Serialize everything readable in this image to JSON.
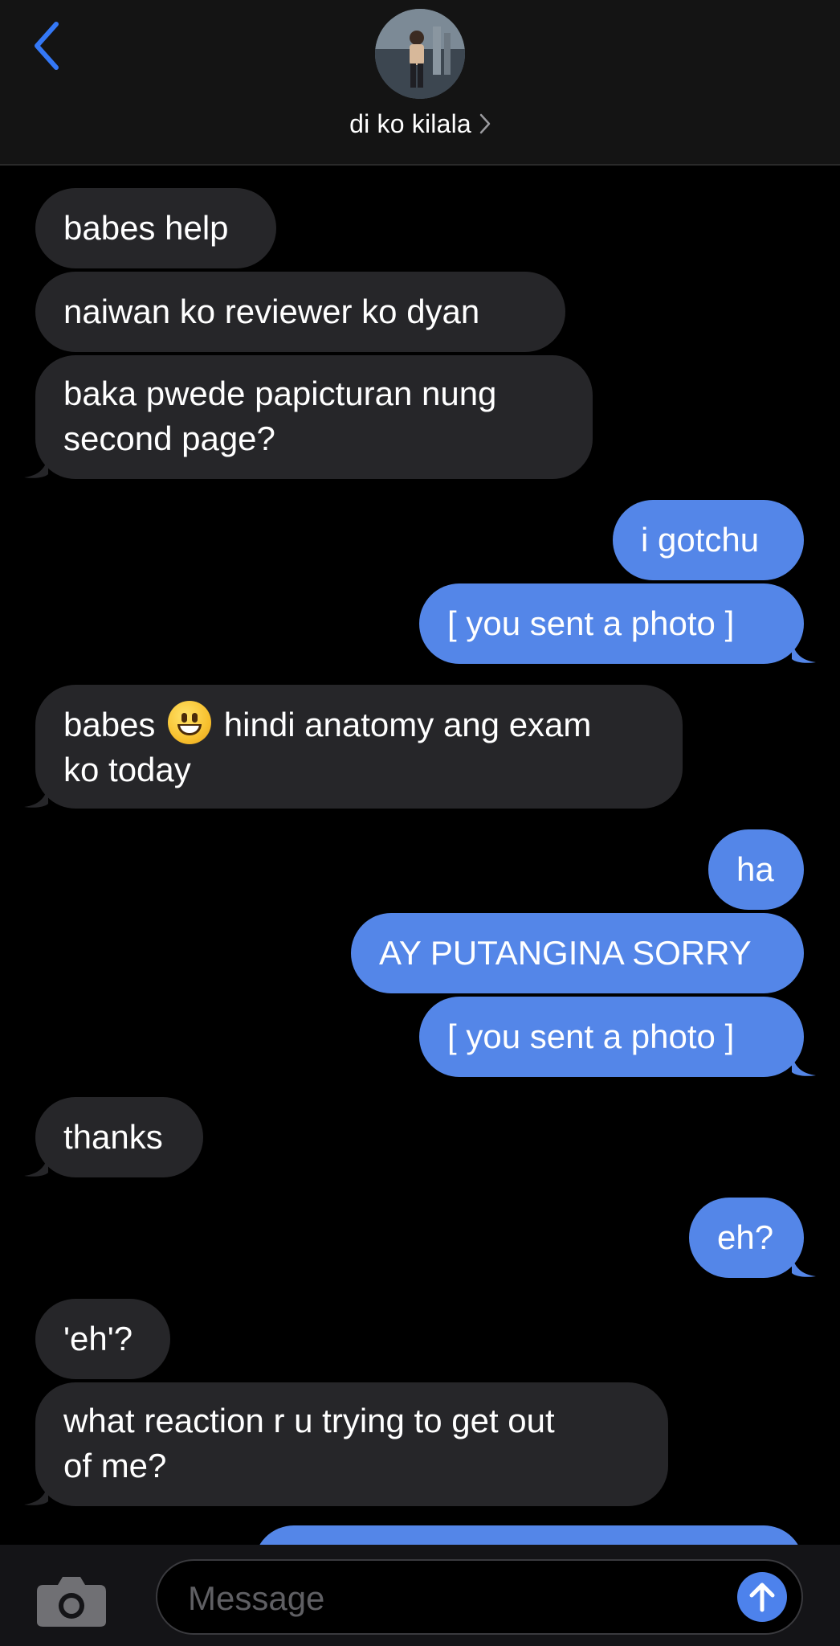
{
  "header": {
    "contact_name": "di ko kilala"
  },
  "messages": [
    {
      "direction": "incoming",
      "lines": [
        "babes help"
      ]
    },
    {
      "direction": "incoming",
      "lines": [
        "naiwan ko reviewer ko dyan"
      ]
    },
    {
      "direction": "incoming",
      "lines": [
        "baka pwede papicturan nung",
        "second page?"
      ]
    },
    {
      "direction": "outgoing",
      "lines": [
        "i gotchu"
      ]
    },
    {
      "direction": "outgoing",
      "lines": [
        "[ you sent a photo ]"
      ]
    },
    {
      "direction": "incoming",
      "lines": [
        "babes",
        "hindi anatomy ang exam",
        "ko today"
      ],
      "emoji": "grinning-face"
    },
    {
      "direction": "outgoing",
      "lines": [
        "ha"
      ]
    },
    {
      "direction": "outgoing",
      "lines": [
        "AY PUTANGINA SORRY"
      ]
    },
    {
      "direction": "outgoing",
      "lines": [
        "[ you sent a photo ]"
      ]
    },
    {
      "direction": "incoming",
      "lines": [
        "thanks"
      ]
    },
    {
      "direction": "outgoing",
      "lines": [
        "eh?"
      ]
    },
    {
      "direction": "incoming",
      "lines": [
        "'eh'?"
      ]
    },
    {
      "direction": "incoming",
      "lines": [
        "what reaction r u trying to get out",
        "of me?"
      ]
    }
  ],
  "composer": {
    "placeholder": "Message"
  },
  "icons": {
    "back": "chevron-left-icon",
    "camera": "camera-icon",
    "send": "arrow-up-icon",
    "contact_chevron": "chevron-right-icon"
  },
  "colors": {
    "incoming_bubble": "#262629",
    "outgoing_bubble": "#5486e8",
    "accent": "#3478f6"
  }
}
